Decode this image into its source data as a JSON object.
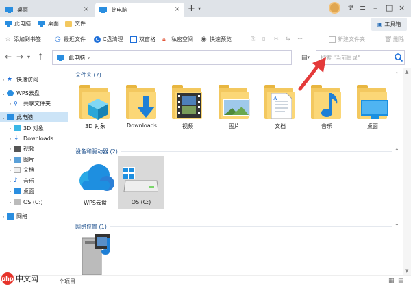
{
  "tabs": [
    {
      "label": "桌面",
      "active": false
    },
    {
      "label": "此电脑",
      "active": true
    }
  ],
  "bookmarks": [
    {
      "label": "此电脑"
    },
    {
      "label": "桌面"
    },
    {
      "label": "文件"
    }
  ],
  "toolbox_label": "工具箱",
  "actions": [
    {
      "label": "添加到书签",
      "icon": "star-icon"
    },
    {
      "label": "最近文件",
      "icon": "clock-icon"
    },
    {
      "label": "C盘清理",
      "icon": "c-clean-icon"
    },
    {
      "label": "双窗格",
      "icon": "split-pane-icon"
    },
    {
      "label": "私密空间",
      "icon": "lock-icon"
    },
    {
      "label": "快速预览",
      "icon": "eye-icon"
    },
    {
      "label": "新建文件夹",
      "icon": "new-folder-icon"
    },
    {
      "label": "删除",
      "icon": "trash-icon"
    }
  ],
  "address": {
    "path": "此电脑"
  },
  "search": {
    "placeholder": "搜索 \"当前目录\""
  },
  "sidebar": {
    "items": [
      {
        "label": "快速访问",
        "icon": "star-icon"
      },
      {
        "label": "WPS云盘",
        "icon": "cloud-icon"
      },
      {
        "label": "共享文件夹",
        "icon": "share-icon"
      },
      {
        "label": "此电脑",
        "icon": "computer-icon"
      },
      {
        "label": "3D 对象",
        "icon": "cube-icon"
      },
      {
        "label": "Downloads",
        "icon": "download-icon"
      },
      {
        "label": "视频",
        "icon": "video-icon"
      },
      {
        "label": "图片",
        "icon": "picture-icon"
      },
      {
        "label": "文档",
        "icon": "document-icon"
      },
      {
        "label": "音乐",
        "icon": "music-icon"
      },
      {
        "label": "桌面",
        "icon": "desktop-icon"
      },
      {
        "label": "OS (C:)",
        "icon": "drive-icon"
      },
      {
        "label": "网络",
        "icon": "network-icon"
      }
    ]
  },
  "sections": {
    "folders": {
      "title": "文件夹 (7)"
    },
    "devices": {
      "title": "设备和驱动器 (2)"
    },
    "network": {
      "title": "网络位置 (1)"
    }
  },
  "folders": [
    {
      "label": "3D 对象"
    },
    {
      "label": "Downloads"
    },
    {
      "label": "视频"
    },
    {
      "label": "图片"
    },
    {
      "label": "文档"
    },
    {
      "label": "音乐"
    },
    {
      "label": "桌面"
    }
  ],
  "devices": [
    {
      "label": "WPS云盘"
    },
    {
      "label": "OS (C:)"
    }
  ],
  "status": {
    "text": "个项目"
  },
  "watermark": {
    "text": "中文网"
  },
  "colors": {
    "accent": "#1e6fd9",
    "selection": "#cce4f7",
    "folder": "#f3c85f",
    "arrow": "#e43a3a"
  }
}
